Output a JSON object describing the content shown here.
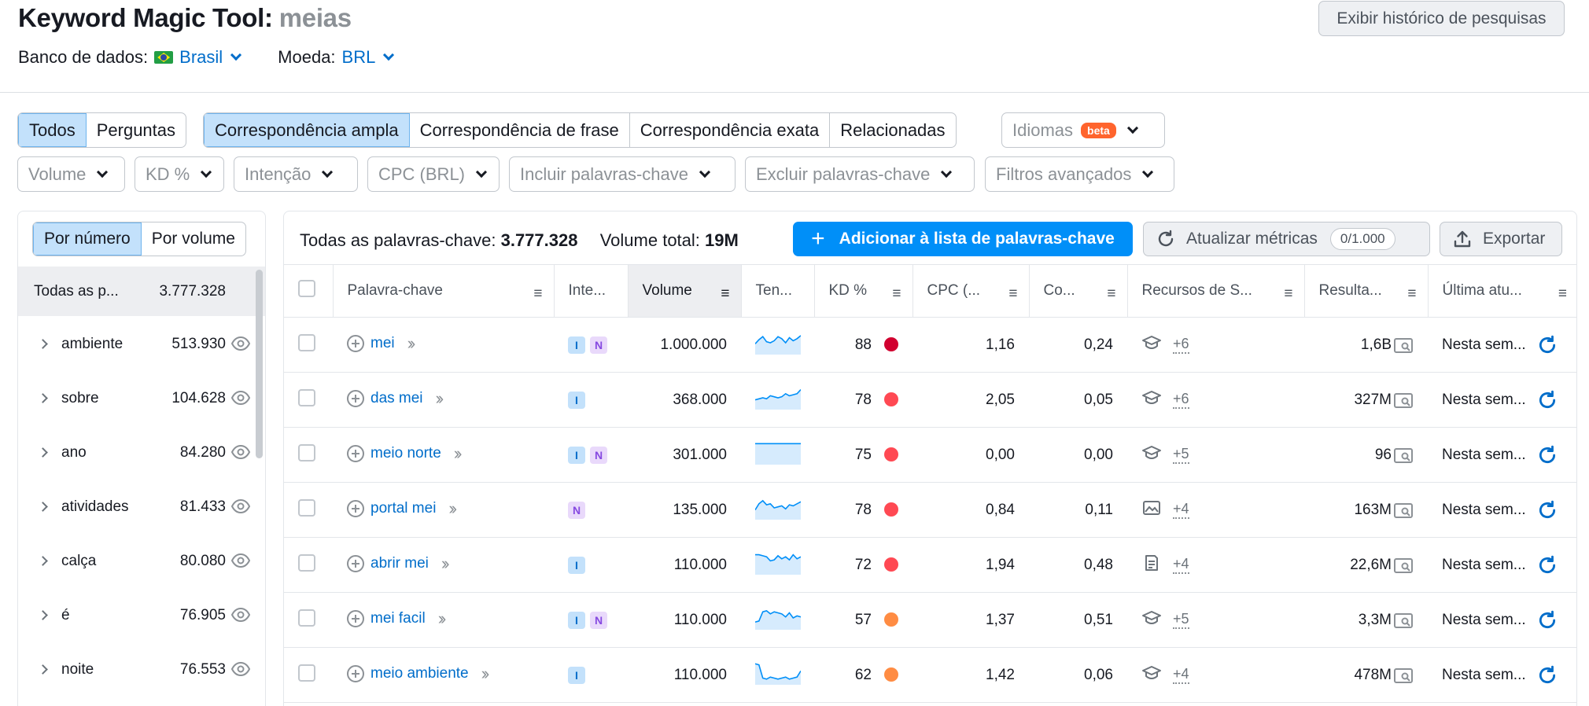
{
  "header": {
    "title": "Keyword Magic Tool:",
    "query": "meias",
    "history_button": "Exibir histórico de pesquisas",
    "database_label": "Banco de dados:",
    "database_value": "Brasil",
    "currency_label": "Moeda:",
    "currency_value": "BRL"
  },
  "filters": {
    "question_tabs": [
      "Todos",
      "Perguntas"
    ],
    "match_tabs": [
      "Correspondência ampla",
      "Correspondência de frase",
      "Correspondência exata",
      "Relacionadas"
    ],
    "languages_label": "Idiomas",
    "languages_badge": "beta",
    "dropdowns": [
      "Volume",
      "KD %",
      "Intenção",
      "CPC (BRL)",
      "Incluir palavras-chave",
      "Excluir palavras-chave",
      "Filtros avançados"
    ]
  },
  "sidebar": {
    "toggle": [
      "Por número",
      "Por volume"
    ],
    "all_label": "Todas as p...",
    "all_count": "3.777.328",
    "groups": [
      {
        "label": "ambiente",
        "count": "513.930"
      },
      {
        "label": "sobre",
        "count": "104.628"
      },
      {
        "label": "ano",
        "count": "84.280"
      },
      {
        "label": "atividades",
        "count": "81.433"
      },
      {
        "label": "calça",
        "count": "80.080"
      },
      {
        "label": "é",
        "count": "76.905"
      },
      {
        "label": "noite",
        "count": "76.553"
      }
    ]
  },
  "main": {
    "all_keywords_label": "Todas as palavras-chave:",
    "all_keywords_value": "3.777.328",
    "total_volume_label": "Volume total:",
    "total_volume_value": "19M",
    "add_button": "Adicionar à lista de palavras-chave",
    "update_button": "Atualizar métricas",
    "update_count": "0/1.000",
    "export_button": "Exportar",
    "columns": [
      "Palavra-chave",
      "Inte...",
      "Volume",
      "Ten...",
      "KD %",
      "CPC (...",
      "Co...",
      "Recursos de S...",
      "Resulta...",
      "Última atu..."
    ],
    "rows": [
      {
        "keyword": "mei",
        "intents": [
          "I",
          "N"
        ],
        "volume": "1.000.000",
        "trend": [
          0.55,
          0.35,
          0.2,
          0.45,
          0.5,
          0.4,
          0.2,
          0.3,
          0.5,
          0.25,
          0.4,
          0.3,
          0.15
        ],
        "kd": "88",
        "kd_color": "#d1002f",
        "cpc": "1,16",
        "com": "0,24",
        "feature_icon": "graduation-cap-icon",
        "features_more": "+6",
        "results": "1,6B",
        "updated": "Nesta sem..."
      },
      {
        "keyword": "das mei",
        "intents": [
          "I"
        ],
        "volume": "368.000",
        "trend": [
          0.6,
          0.55,
          0.5,
          0.55,
          0.4,
          0.45,
          0.5,
          0.45,
          0.3,
          0.4,
          0.35,
          0.3,
          0.1
        ],
        "kd": "78",
        "kd_color": "#ff4953",
        "cpc": "2,05",
        "com": "0,05",
        "feature_icon": "graduation-cap-icon",
        "features_more": "+6",
        "results": "327M",
        "updated": "Nesta sem..."
      },
      {
        "keyword": "meio norte",
        "intents": [
          "I",
          "N"
        ],
        "volume": "301.000",
        "trend": [
          0.05,
          0.05,
          0.05,
          0.05,
          0.05,
          0.05,
          0.05,
          0.05,
          0.05,
          0.05,
          0.05,
          0.05,
          0.05
        ],
        "kd": "75",
        "kd_color": "#ff4953",
        "cpc": "0,00",
        "com": "0,00",
        "feature_icon": "graduation-cap-icon",
        "features_more": "+5",
        "results": "96",
        "updated": "Nesta sem..."
      },
      {
        "keyword": "portal mei",
        "intents": [
          "N"
        ],
        "volume": "135.000",
        "trend": [
          0.6,
          0.3,
          0.15,
          0.35,
          0.3,
          0.5,
          0.45,
          0.4,
          0.55,
          0.35,
          0.4,
          0.3,
          0.2
        ],
        "kd": "78",
        "kd_color": "#ff4953",
        "cpc": "0,84",
        "com": "0,11",
        "feature_icon": "image-icon",
        "features_more": "+4",
        "results": "163M",
        "updated": "Nesta sem..."
      },
      {
        "keyword": "abrir mei",
        "intents": [
          "I"
        ],
        "volume": "110.000",
        "trend": [
          0.1,
          0.1,
          0.15,
          0.2,
          0.4,
          0.35,
          0.15,
          0.3,
          0.2,
          0.35,
          0.1,
          0.3,
          0.2
        ],
        "kd": "72",
        "kd_color": "#ff4953",
        "cpc": "1,94",
        "com": "0,48",
        "feature_icon": "document-icon",
        "features_more": "+4",
        "results": "22,6M",
        "updated": "Nesta sem..."
      },
      {
        "keyword": "mei facil",
        "intents": [
          "I",
          "N"
        ],
        "volume": "110.000",
        "trend": [
          0.7,
          0.65,
          0.2,
          0.15,
          0.3,
          0.2,
          0.25,
          0.3,
          0.45,
          0.25,
          0.5,
          0.4,
          0.45
        ],
        "kd": "57",
        "kd_color": "#ff8c43",
        "cpc": "1,37",
        "com": "0,51",
        "feature_icon": "graduation-cap-icon",
        "features_more": "+5",
        "results": "3,3M",
        "updated": "Nesta sem..."
      },
      {
        "keyword": "meio ambiente",
        "intents": [
          "I"
        ],
        "volume": "110.000",
        "trend": [
          0.05,
          0.1,
          0.75,
          0.8,
          0.7,
          0.75,
          0.8,
          0.75,
          0.7,
          0.8,
          0.75,
          0.7,
          0.4
        ],
        "kd": "62",
        "kd_color": "#ff8c43",
        "cpc": "1,42",
        "com": "0,06",
        "feature_icon": "graduation-cap-icon",
        "features_more": "+4",
        "results": "478M",
        "updated": "Nesta sem..."
      }
    ]
  },
  "colors": {
    "accent": "#008ff8",
    "link": "#006dca",
    "active_tab_bg": "#c3e1fb",
    "trend_fill": "#d6ebfd",
    "trend_line": "#008ff8"
  }
}
